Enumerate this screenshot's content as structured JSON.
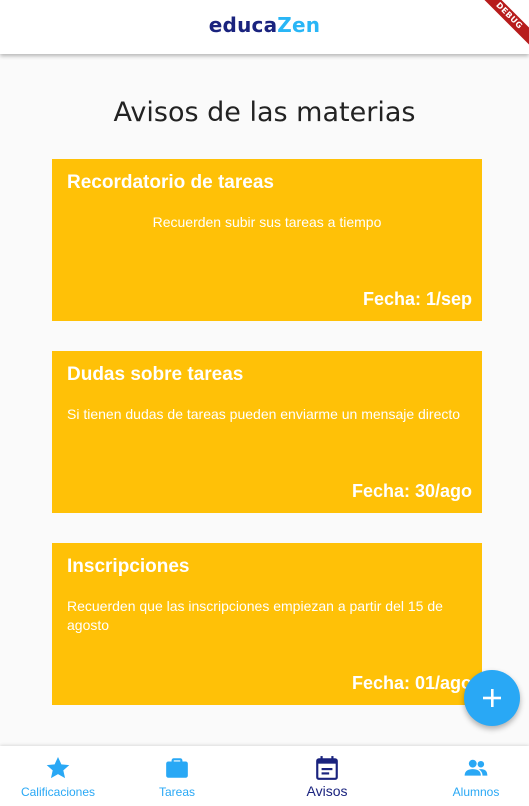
{
  "app": {
    "logo_part1": "educa",
    "logo_part2": "Zen",
    "debug_label": "DEBUG"
  },
  "page": {
    "title": "Avisos de las materias"
  },
  "cards": [
    {
      "title": "Recordatorio de tareas",
      "body": "Recuerden subir sus tareas a tiempo",
      "date": "Fecha: 1/sep"
    },
    {
      "title": "Dudas sobre tareas",
      "body": "Si tienen dudas de tareas pueden enviarme un mensaje directo",
      "date": "Fecha: 30/ago"
    },
    {
      "title": "Inscripciones",
      "body": "Recuerden que las inscripciones empiezan a partir del 15 de agosto",
      "date": "Fecha: 01/ago"
    }
  ],
  "fab": {
    "icon": "plus-icon"
  },
  "nav": {
    "items": [
      {
        "label": "Calificaciones",
        "icon": "star-icon"
      },
      {
        "label": "Tareas",
        "icon": "briefcase-icon"
      },
      {
        "label": "Avisos",
        "icon": "calendar-icon",
        "active": true
      },
      {
        "label": "Alumnos",
        "icon": "people-icon"
      }
    ]
  },
  "colors": {
    "card": "#ffc107",
    "accent": "#29a8f5",
    "active_nav": "#1a237e",
    "logo_dark": "#1a237e",
    "logo_light": "#29b6f6"
  }
}
